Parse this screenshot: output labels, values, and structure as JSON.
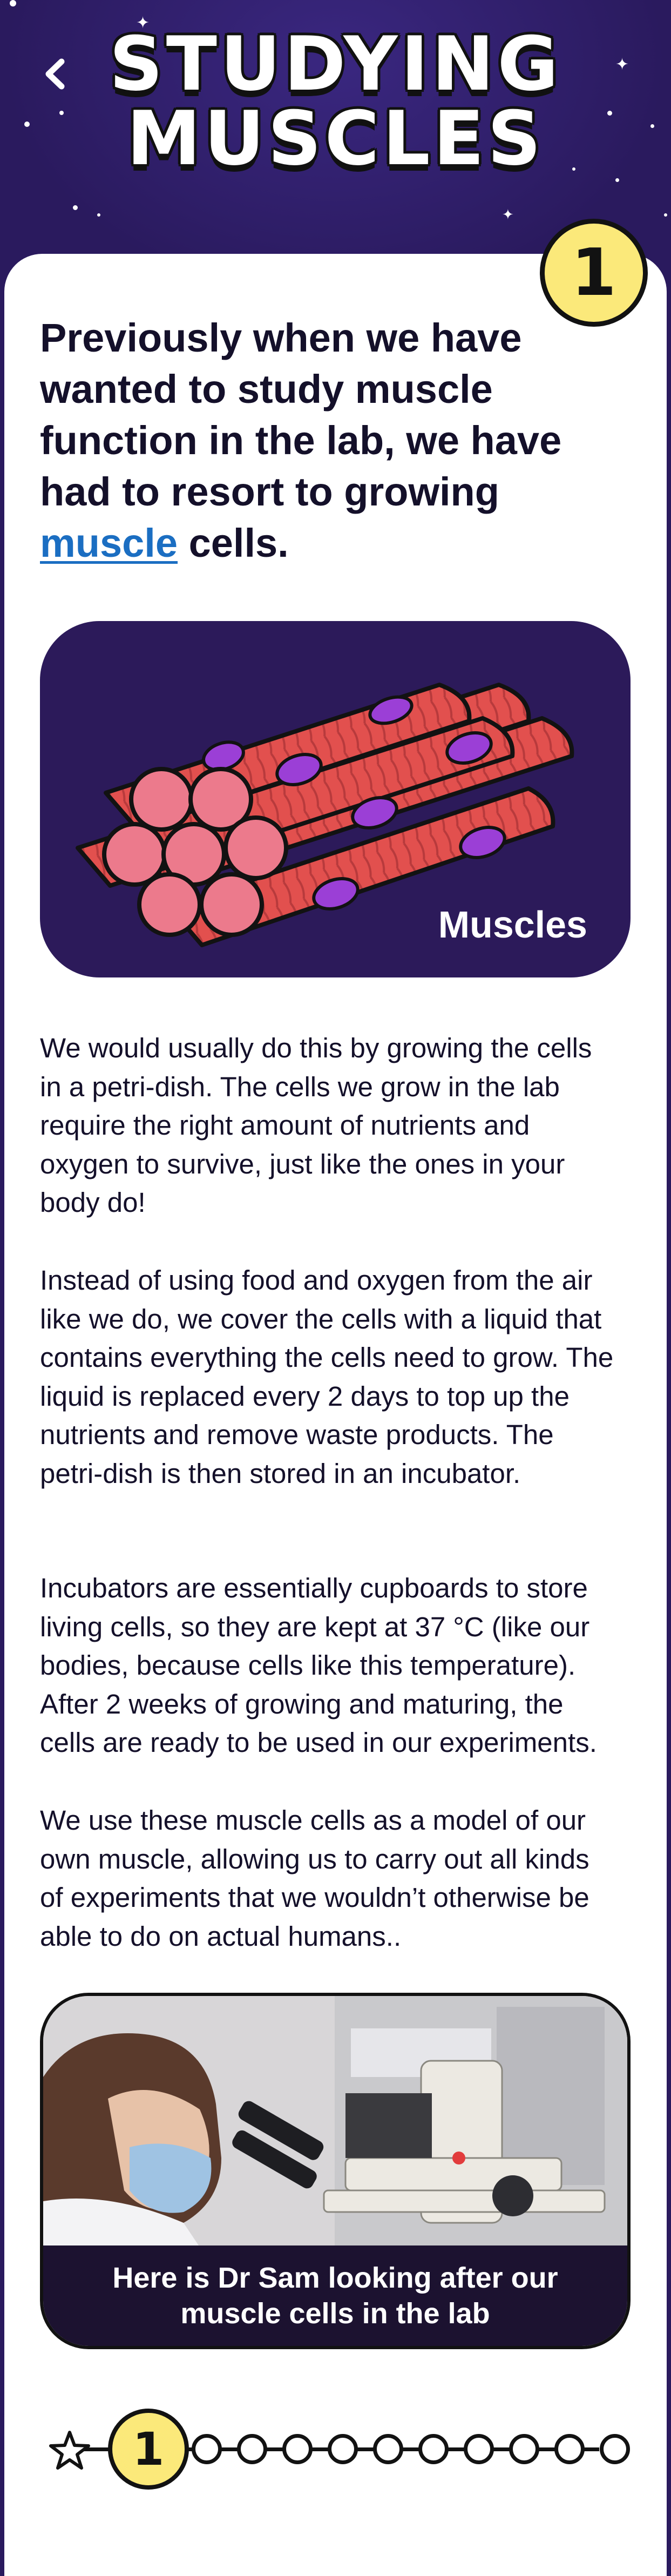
{
  "header": {
    "title_line1": "STUDYING",
    "title_line2": "MUSCLES",
    "back_icon": "chevron-left-icon"
  },
  "page_badge": "1",
  "lead": {
    "text_before": "Previously when we have wanted to study muscle function in the lab, we have had to resort to growing ",
    "link_text": "muscle",
    "text_after": " cells."
  },
  "illustration": {
    "label": "Muscles"
  },
  "paragraphs": [
    "We would usually do this by growing the cells in a petri-dish. The cells we grow in the lab require the right amount of nutrients and oxygen to survive, just like the ones in your body do!",
    "Instead of using food and oxygen from the air like we do, we cover the cells with a liquid that contains everything the cells need to grow. The liquid is replaced every 2 days to top up the nutrients and remove waste products. The petri-dish is then stored in an incubator.",
    "Incubators are essentially cupboards to store living cells, so they are kept at 37 °C (like our bodies, because cells like this temperature).  After 2 weeks of growing and maturing, the cells are ready to be used in our experiments.",
    "We use these muscle cells as a model of our own muscle, allowing us to carry out all kinds of experiments that we wouldn’t otherwise be able to do on actual humans.."
  ],
  "photo": {
    "caption": "Here is Dr Sam looking after our muscle cells in the lab"
  },
  "pager": {
    "current": "1",
    "total_pages": 11,
    "star_icon": "star-icon"
  },
  "colors": {
    "background": "#2a1a5e",
    "badge_yellow": "#fbe97a",
    "link_blue": "#1b6ec2",
    "muscle_red": "#e2504e",
    "muscle_end": "#ec7a8c",
    "nucleus_purple": "#9b3fd6"
  }
}
